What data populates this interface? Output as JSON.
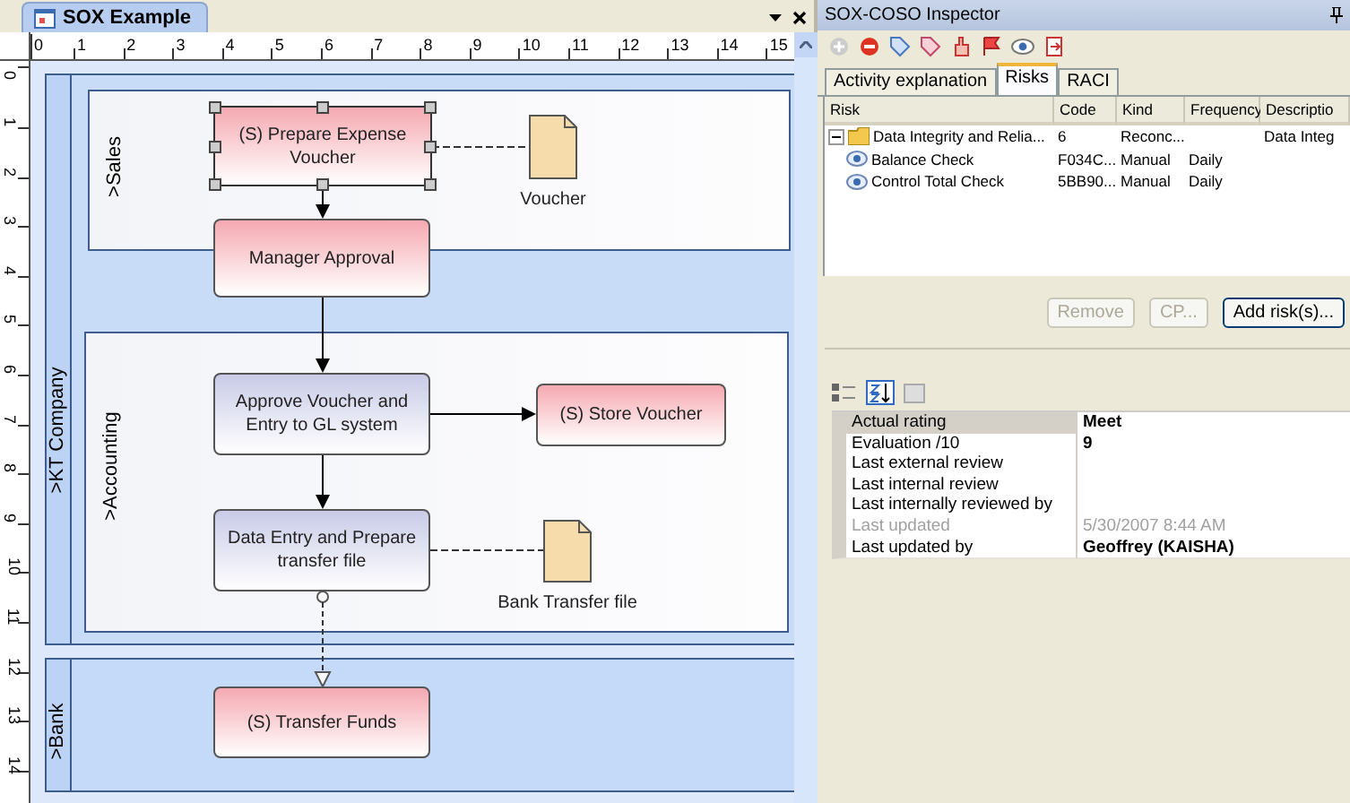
{
  "document_tab": {
    "title": "SOX Example",
    "selected": true
  },
  "ruler": {
    "horizontal": [
      "0",
      "1",
      "2",
      "3",
      "4",
      "5",
      "6",
      "7",
      "8",
      "9",
      "10",
      "11",
      "12",
      "13",
      "14",
      "15"
    ],
    "vertical": [
      "0",
      "1",
      "2",
      "3",
      "4",
      "5",
      "6",
      "7",
      "8",
      "9",
      "10",
      "11",
      "12",
      "13",
      "14"
    ]
  },
  "pools": [
    {
      "label": ">KT Company",
      "lanes": [
        {
          "label": ">Sales"
        },
        {
          "label": ">Accounting"
        }
      ]
    },
    {
      "label": ">Bank"
    }
  ],
  "nodes": [
    {
      "kind": "service",
      "label": "(S) Prepare Expense Voucher",
      "selected": true
    },
    {
      "kind": "service",
      "label": "Manager Approval",
      "selected": false
    },
    {
      "kind": "document",
      "label": "Voucher",
      "selected": false
    },
    {
      "kind": "task",
      "label": "Approve Voucher and Entry to GL system",
      "selected": false
    },
    {
      "kind": "service",
      "label": "(S) Store Voucher",
      "selected": false
    },
    {
      "kind": "task",
      "label": "Data Entry and Prepare transfer file",
      "selected": false
    },
    {
      "kind": "document",
      "label": "Bank Transfer file",
      "selected": false
    },
    {
      "kind": "service",
      "label": "(S) Transfer Funds",
      "selected": false
    }
  ],
  "connectors": [
    {
      "kind": "flow"
    },
    {
      "kind": "flow"
    },
    {
      "kind": "flow"
    },
    {
      "kind": "flow"
    },
    {
      "kind": "message"
    },
    {
      "kind": "association"
    },
    {
      "kind": "association"
    }
  ],
  "inspector": {
    "title": "SOX-COSO Inspector",
    "tabs": [
      {
        "label": "Activity explanation",
        "selected": false
      },
      {
        "label": "Risks",
        "selected": true
      },
      {
        "label": "RACI",
        "selected": false
      }
    ],
    "columns": [
      "Risk",
      "Code",
      "Kind",
      "Frequency",
      "Descriptio"
    ],
    "risks": [
      {
        "risk": "Data Integrity and Relia...",
        "code": "6",
        "kind": "Reconc...",
        "description": "Data Integ",
        "expanded": true,
        "children": [
          {
            "risk": "Balance Check",
            "code": "F034C...",
            "kind": "Manual",
            "frequency": "Daily"
          },
          {
            "risk": "Control Total Check",
            "code": "5BB90...",
            "kind": "Manual",
            "frequency": "Daily"
          }
        ]
      }
    ],
    "buttons": [
      {
        "label": "Remove",
        "disabled": true
      },
      {
        "label": "CP...",
        "disabled": true
      },
      {
        "label": "Add risk(s)...",
        "disabled": false
      }
    ],
    "properties": [
      {
        "name": "Actual rating",
        "value": "Meet",
        "bold": true,
        "selected": true,
        "disabled": false
      },
      {
        "name": "Evaluation /10",
        "value": "9",
        "bold": true,
        "selected": false,
        "disabled": false
      },
      {
        "name": "Last external review",
        "selected": false,
        "disabled": false
      },
      {
        "name": "Last internal review",
        "selected": false,
        "disabled": false
      },
      {
        "name": "Last internally reviewed by",
        "selected": false,
        "disabled": false
      },
      {
        "name": "Last updated",
        "value": "5/30/2007 8:44 AM",
        "bold": false,
        "selected": false,
        "disabled": true
      },
      {
        "name": "Last updated by",
        "value": "Geoffrey (KAISHA)",
        "bold": true,
        "selected": false,
        "disabled": false
      }
    ]
  }
}
